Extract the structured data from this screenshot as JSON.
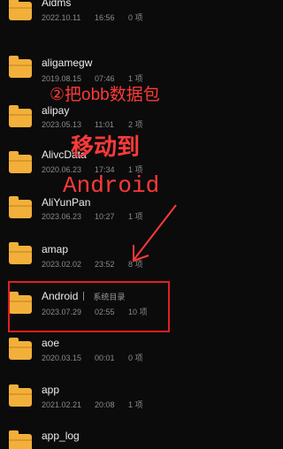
{
  "files": [
    {
      "name": "Aidms",
      "date": "2022.10.11",
      "time": "16:56",
      "count": "0 项"
    },
    {
      "name": "aligamegw",
      "date": "2019.08.15",
      "time": "07:46",
      "count": "1 项"
    },
    {
      "name": "alipay",
      "date": "2023.05.13",
      "time": "11:01",
      "count": "2 项"
    },
    {
      "name": "AlivcData",
      "date": "2020.06.23",
      "time": "17:34",
      "count": "1 项"
    },
    {
      "name": "AliYunPan",
      "date": "2023.06.23",
      "time": "10:27",
      "count": "1 项"
    },
    {
      "name": "amap",
      "date": "2023.02.02",
      "time": "23:52",
      "count": "8 项"
    },
    {
      "name": "Android",
      "tag": "系统目录",
      "date": "2023.07.29",
      "time": "02:55",
      "count": "10 项"
    },
    {
      "name": "aoe",
      "date": "2020.03.15",
      "time": "00:01",
      "count": "0 项"
    },
    {
      "name": "app",
      "date": "2021.02.21",
      "time": "20:08",
      "count": "1 项"
    },
    {
      "name": "app_log",
      "date": "",
      "time": "",
      "count": ""
    }
  ],
  "annotation": {
    "step": "②把obb数据包",
    "move": "移动到",
    "target": "Android"
  },
  "colors": {
    "folder": "#f2b03a",
    "annotation": "#ff3a3a",
    "highlight_border": "#e02020"
  }
}
